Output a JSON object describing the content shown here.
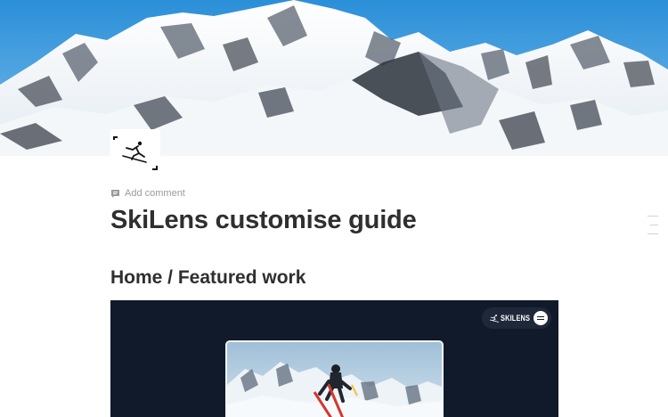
{
  "cover": {
    "image": "snowy-mountain-range-photo"
  },
  "page": {
    "icon": "skier-icon",
    "add_comment_label": "Add comment",
    "title": "SkiLens customise guide"
  },
  "content": {
    "heading": "Home / Featured work",
    "embed": {
      "brand": "SKILENS",
      "menu_icon": "hamburger-menu-icon",
      "hero_image": "ski-jumper-mountain-photo"
    }
  },
  "colors": {
    "embed_background": "#101a2b",
    "text": "#37352f",
    "muted": "#9b9a97"
  }
}
